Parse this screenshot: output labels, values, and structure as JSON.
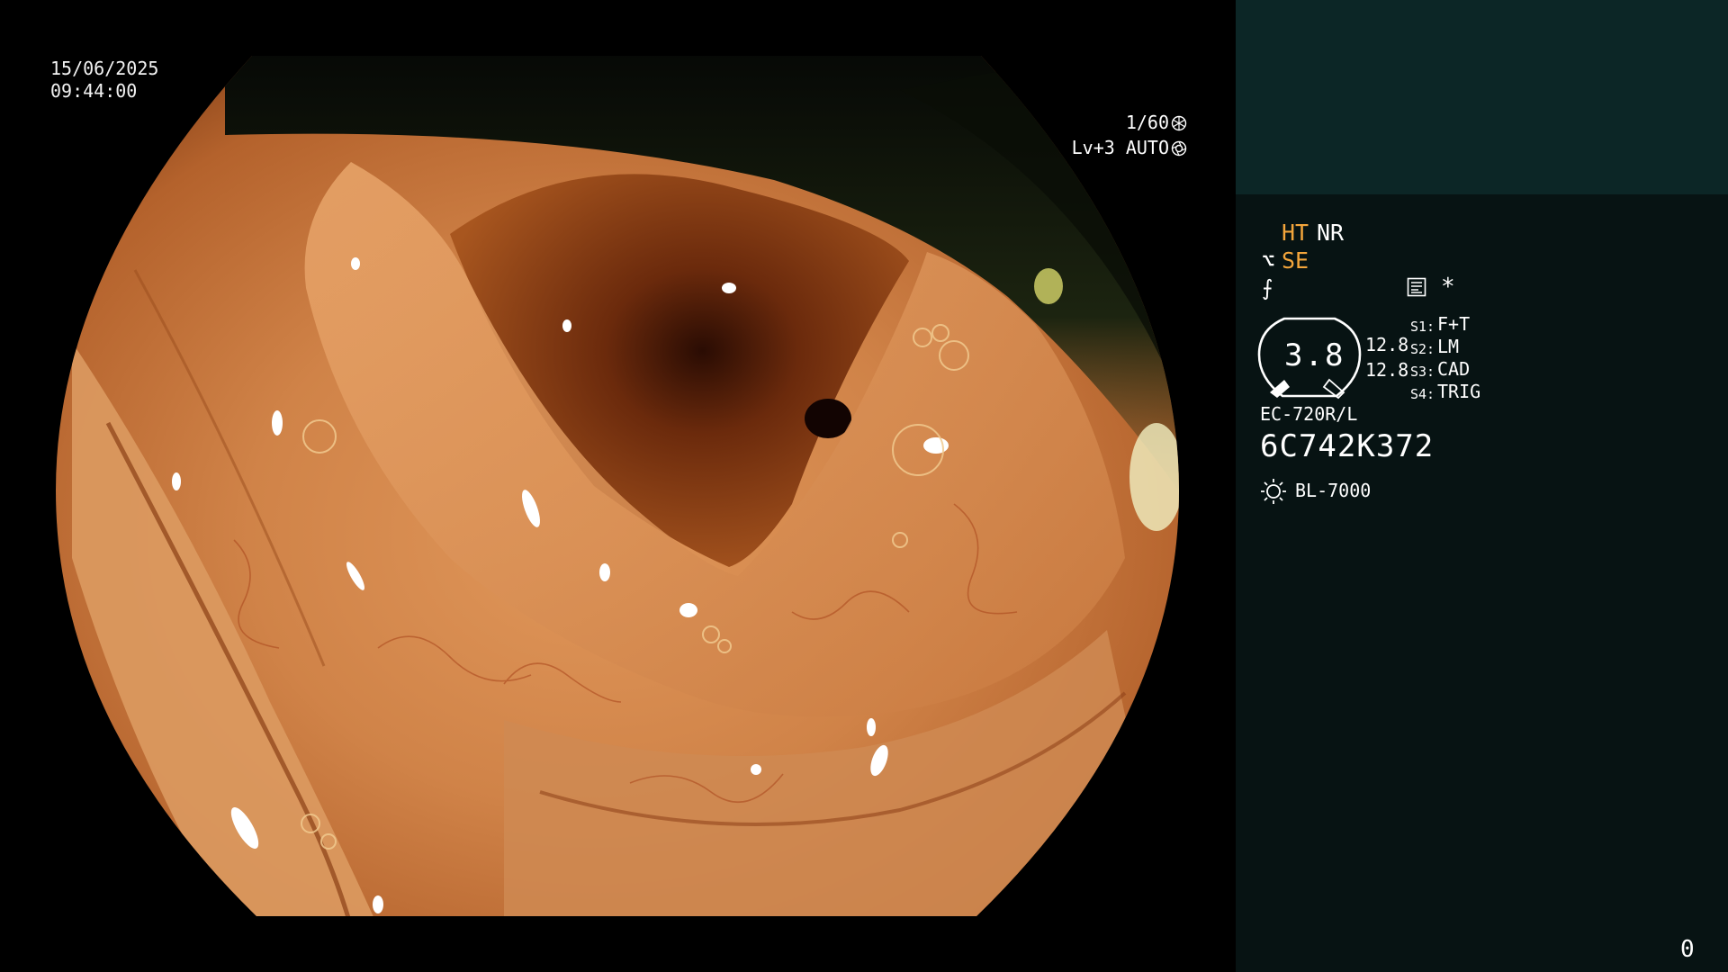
{
  "osd": {
    "date": "15/06/2025",
    "time": "09:44:00",
    "shutter": "1/60",
    "level": "Lv+3 AUTO"
  },
  "panel": {
    "ht": "HT",
    "nr": "NR",
    "se": "SE",
    "se_icon": "⌥",
    "fn_icon": "⨍",
    "asterisk": "*",
    "gauge_value": "3.8",
    "value_a": "12.8",
    "value_b": "12.8",
    "scope_buttons": [
      {
        "key": "S1:",
        "value": "F+T"
      },
      {
        "key": "S2:",
        "value": "LM"
      },
      {
        "key": "S3:",
        "value": "CAD"
      },
      {
        "key": "S4:",
        "value": "TRIG"
      }
    ],
    "model": "EC-720R/L",
    "serial": "6C742K372",
    "light_source": "BL-7000",
    "counter": "0"
  },
  "colors": {
    "accent_orange": "#f3a53b",
    "panel_top": "#0c2626",
    "panel_bg": "#071313"
  },
  "icons": [
    "aperture-icon",
    "iris-icon",
    "scope-se-icon",
    "function-icon",
    "memo-icon",
    "light-source-icon"
  ]
}
